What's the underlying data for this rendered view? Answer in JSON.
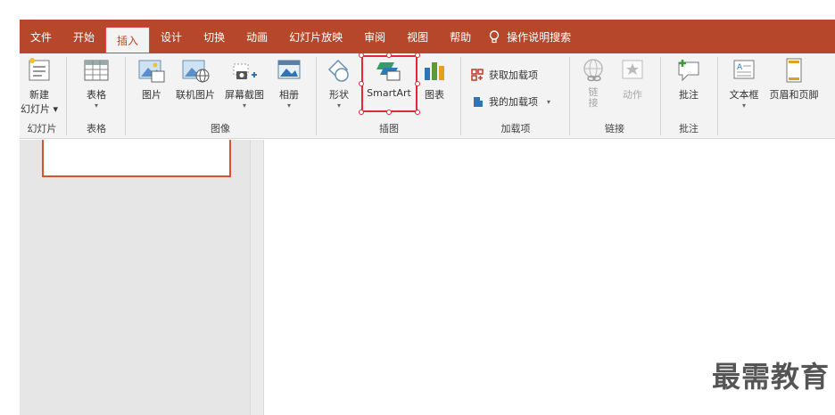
{
  "tabs": [
    "文件",
    "开始",
    "插入",
    "设计",
    "切换",
    "动画",
    "幻灯片放映",
    "审阅",
    "视图",
    "帮助"
  ],
  "active_tab": "插入",
  "tell_me": "操作说明搜索",
  "ribbon": {
    "new_slide": {
      "line1": "新建",
      "line2": "幻灯片 ▾"
    },
    "table": "表格",
    "picture": "图片",
    "online_picture": "联机图片",
    "screenshot": "屏幕截图",
    "album": "相册",
    "shapes": "形状",
    "smartart": "SmartArt",
    "chart": "图表",
    "get_addins": "获取加载项",
    "my_addins": "我的加载项",
    "link": "链接",
    "action": "动作",
    "comment": "批注",
    "textbox": "文本框",
    "header_footer": "页眉和页脚",
    "groups": {
      "slides": "幻灯片",
      "tables": "表格",
      "images": "图像",
      "illustrations": "插图",
      "addins": "加载项",
      "links": "链接",
      "comments": "批注"
    }
  },
  "watermark": "最需教育",
  "colors": {
    "accent": "#b7472a",
    "highlight": "#e0283a"
  }
}
